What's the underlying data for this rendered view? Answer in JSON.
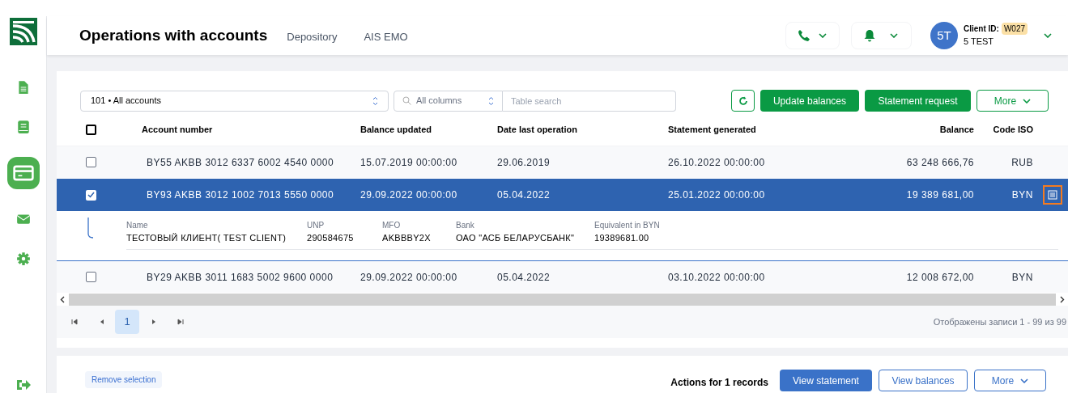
{
  "header": {
    "title": "Operations with accounts",
    "nav": [
      "Depository",
      "AIS EMO"
    ],
    "client_id_label": "Client ID:",
    "client_id": "W027",
    "avatar": "5T",
    "client_name": "5 TEST"
  },
  "sidebar": {
    "items": [
      {
        "selected": false
      },
      {
        "selected": false
      },
      {
        "selected": true
      },
      {
        "selected": false
      },
      {
        "selected": false
      }
    ]
  },
  "toolbar": {
    "account_select": "101 • All accounts",
    "column_select": "All columns",
    "search": {
      "placeholder": "Table search"
    },
    "buttons": [
      {
        "label": "Update balances",
        "kind": "primary"
      },
      {
        "label": "Statement request",
        "kind": "primary"
      },
      {
        "label": "More",
        "kind": "outline"
      }
    ]
  },
  "table": {
    "all_checked": false,
    "columns": [
      "Account number",
      "Balance updated",
      "Date last operation",
      "Statement generated",
      "Balance",
      "Code ISO"
    ],
    "rows": [
      {
        "selected": false,
        "cells": [
          "BY55 AKBB 3012 6337 6002 4540 0000",
          "15.07.2019 00:00:00",
          "29.06.2019",
          "26.10.2022 00:00:00",
          "63 248 666,76",
          "RUB"
        ]
      },
      {
        "selected": true,
        "cells": [
          "BY93 AKBB 3012 1002 7013 5550 0000",
          "29.09.2022 00:00:00",
          "05.04.2022",
          "25.01.2022 00:00:00",
          "19 389 681,00",
          "BYN"
        ],
        "details": [
          {
            "label": "Name",
            "value": "ТЕСТОВЫЙ КЛИЕНТ( TEST CLIENT)"
          },
          {
            "label": "UNP",
            "value": "290584675"
          },
          {
            "label": "MFO",
            "value": "AKBBBY2X"
          },
          {
            "label": "Bank",
            "value": "ОАО \"АСБ БЕЛАРУСБАНК\""
          },
          {
            "label": "Equivalent in BYN",
            "value": "19389681.00"
          }
        ]
      },
      {
        "selected": false,
        "cells": [
          "BY29 AKBB 3011 1683 5002 9600 0000",
          "29.09.2022 00:00:00",
          "05.04.2022",
          "03.10.2022 00:00:00",
          "12 008 672,00",
          "BYN"
        ]
      }
    ]
  },
  "pager": {
    "pages": [
      {
        "label": "1",
        "selected": true
      }
    ],
    "summary": "Отображены записи 1 - 99 из 99"
  },
  "actions": {
    "remove_selection": "Remove selection",
    "caption": "Actions for 1 records",
    "buttons": [
      {
        "label": "View statement",
        "kind": "primary"
      },
      {
        "label": "View balances",
        "kind": "outline"
      },
      {
        "label": "More",
        "kind": "outline"
      }
    ]
  }
}
